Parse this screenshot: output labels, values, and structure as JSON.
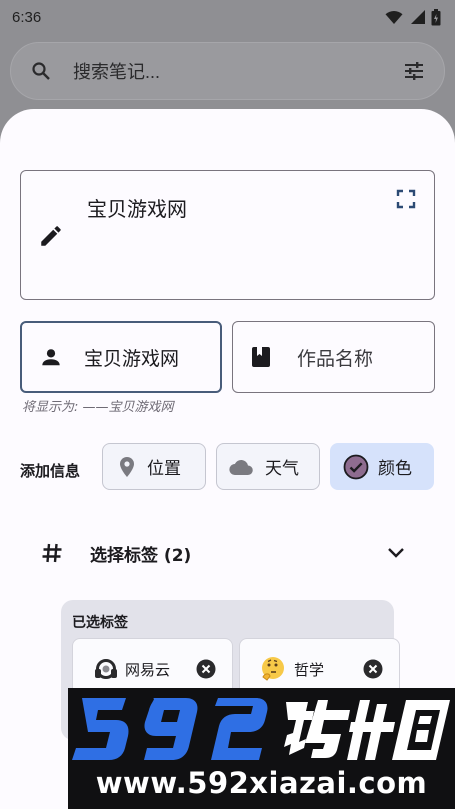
{
  "status_bar": {
    "time": "6:36",
    "icons": [
      "wifi-icon",
      "signal-icon",
      "battery-icon"
    ]
  },
  "search": {
    "placeholder": "搜索笔记...",
    "left_icon": "search-icon",
    "right_icon": "tune-icon"
  },
  "sheet": {
    "title_field": {
      "value": "宝贝游戏网",
      "left_icon": "edit-icon",
      "right_icon": "fullscreen-icon"
    },
    "author_field": {
      "value": "宝贝游戏网",
      "icon": "person-icon"
    },
    "work_field": {
      "placeholder": "作品名称",
      "icon": "book-icon"
    },
    "display_hint": "将显示为: ——宝贝游戏网",
    "add_info": {
      "label": "添加信息",
      "chips": [
        {
          "label": "位置",
          "icon": "location-icon",
          "selected": false
        },
        {
          "label": "天气",
          "icon": "cloud-icon",
          "selected": false
        },
        {
          "label": "颜色",
          "icon": "check-circle-icon",
          "selected": true
        }
      ]
    },
    "tags": {
      "header": "选择标签 (2)",
      "icon": "hash-icon",
      "expand_icon": "chevron-down-icon",
      "selected_title": "已选标签",
      "selected": [
        {
          "label": "网易云",
          "icon": "headphones-emoji"
        },
        {
          "label": "哲学",
          "icon": "thinking-face-emoji"
        }
      ]
    }
  },
  "watermark": {
    "logo_text": "592软件园",
    "url": "www.592xiazai.com"
  },
  "colors": {
    "accent_border": "#485c7a",
    "selected_chip": "#d6e2fb",
    "color_check": "#8e6c8f",
    "watermark_blue": "#2f6fe4"
  }
}
